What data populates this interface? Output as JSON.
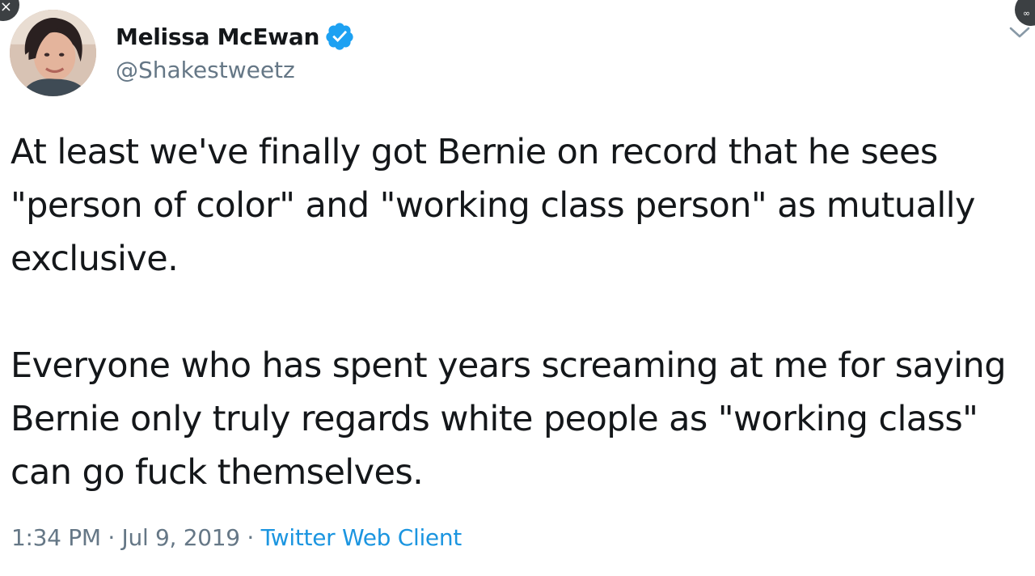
{
  "user": {
    "name": "Melissa McEwan",
    "handle": "@Shakestweetz"
  },
  "tweet": {
    "paragraphs": [
      "At least we've finally got Bernie on record that he sees \"person of color\" and \"working class person\" as mutually exclusive.",
      "Everyone who has spent years screaming at me for saying Bernie only truly regards white people as \"working class\" can go fuck themselves."
    ],
    "time": "1:34 PM",
    "separator": " · ",
    "date": "Jul 9, 2019",
    "source": "Twitter Web Client"
  },
  "controls": {
    "close_glyph": "×",
    "menu_glyph": "∞"
  },
  "colors": {
    "text": "#14171a",
    "secondary": "#657786",
    "link": "#1b95e0",
    "verified": "#1da1f2"
  },
  "icons": [
    "verified-badge-icon",
    "chevron-down-icon",
    "close-icon",
    "more-icon"
  ]
}
